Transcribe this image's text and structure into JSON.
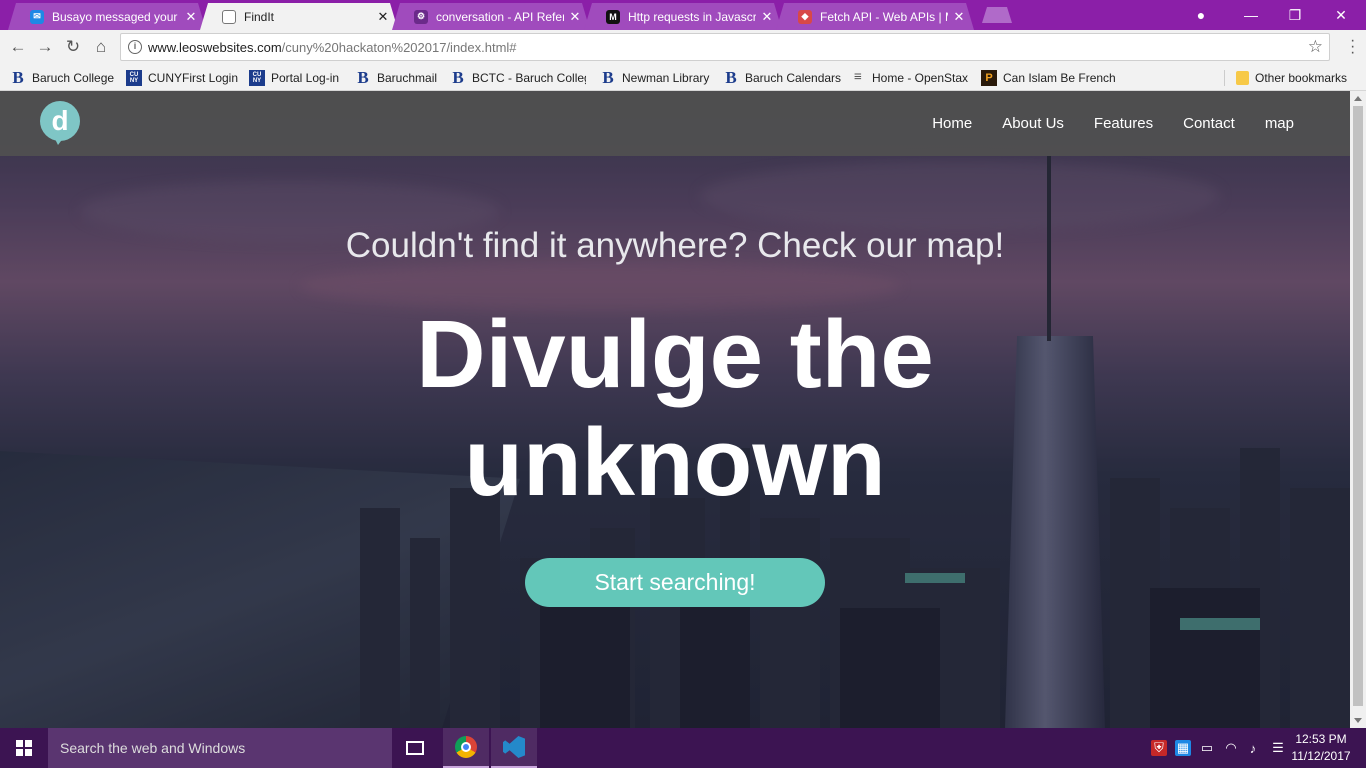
{
  "browser": {
    "tabs": [
      {
        "title": "Busayo messaged your g",
        "favicon": "messenger-icon",
        "active": false
      },
      {
        "title": "FindIt",
        "favicon": "page-icon",
        "active": true
      },
      {
        "title": "conversation - API Refere",
        "favicon": "api-icon",
        "active": false
      },
      {
        "title": "Http requests in Javascrip",
        "favicon": "medium-icon",
        "active": false
      },
      {
        "title": "Fetch API - Web APIs | M",
        "favicon": "mdn-icon",
        "active": false
      }
    ],
    "close_glyph": "✕",
    "address": {
      "domain": "www.leoswebsites.com",
      "path": "/cuny%20hackaton%202017/index.html#"
    },
    "bookmarks": [
      {
        "label": "Baruch College",
        "icon": "baruch-icon"
      },
      {
        "label": "CUNYFirst Login",
        "icon": "cuny-icon"
      },
      {
        "label": "Portal Log-in",
        "icon": "cuny-icon"
      },
      {
        "label": "Baruchmail",
        "icon": "baruch-icon"
      },
      {
        "label": "BCTC - Baruch Colleg",
        "icon": "baruch-icon"
      },
      {
        "label": "Newman Library",
        "icon": "baruch-icon"
      },
      {
        "label": "Baruch Calendars",
        "icon": "baruch-icon"
      },
      {
        "label": "Home - OpenStax",
        "icon": "openstax-icon"
      },
      {
        "label": "Can Islam Be French",
        "icon": "islam-icon"
      }
    ],
    "other_bookmarks": "Other bookmarks"
  },
  "site": {
    "logo_letter": "d",
    "nav": [
      "Home",
      "About Us",
      "Features",
      "Contact",
      "map"
    ],
    "tagline": "Couldn't find it anywhere? Check our map!",
    "headline_line1": "Divulge the",
    "headline_line2": "unknown",
    "cta": "Start searching!"
  },
  "taskbar": {
    "search_placeholder": "Search the web and Windows",
    "time": "12:53 PM",
    "date": "11/12/2017"
  },
  "colors": {
    "tabstrip": "#8b1fa8",
    "accent_teal": "#63c7b9",
    "logo_teal": "#7fc6c6",
    "taskbar": "#3c1452"
  }
}
